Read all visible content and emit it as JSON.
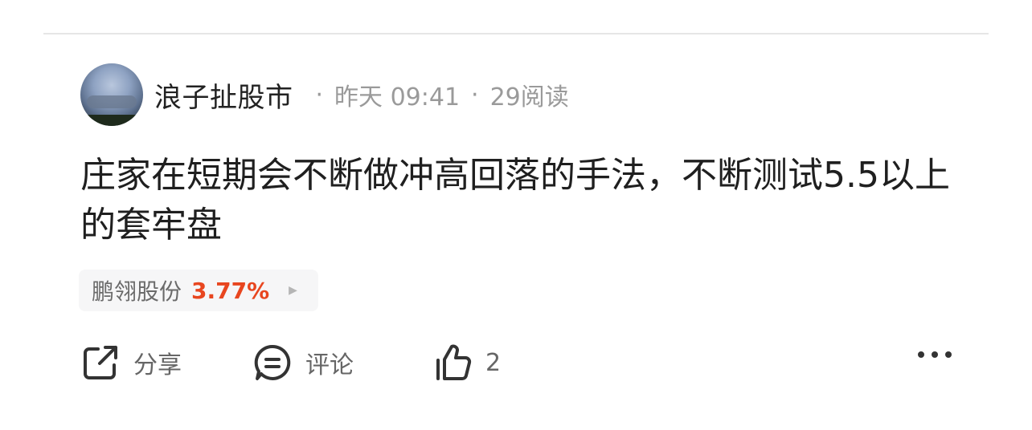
{
  "post": {
    "author": "浪子扯股市",
    "time": "昨天 09:41",
    "reads": "29阅读",
    "separator": "·",
    "content": "庄家在短期会不断做冲高回落的手法，不断测试5.5以上的套牢盘"
  },
  "stock_tag": {
    "name": "鹏翎股份",
    "change": "3.77%",
    "change_color": "#e8461f"
  },
  "actions": {
    "share_label": "分享",
    "comment_label": "评论",
    "like_count": "2"
  },
  "icons": {
    "share": "share-icon",
    "comment": "comment-icon",
    "like": "thumbs-up-icon",
    "more": "more-icon",
    "stock_arrow": "play-arrow-icon"
  }
}
